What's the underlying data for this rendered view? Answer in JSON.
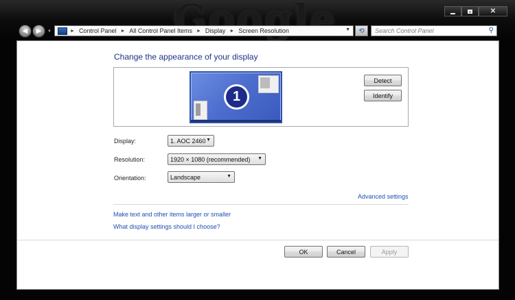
{
  "window": {
    "watermark": "Google",
    "caption": {
      "minimize": "",
      "maximize": "",
      "close": "✕"
    }
  },
  "nav": {
    "back_icon": "back-arrow-icon",
    "forward_icon": "forward-arrow-icon"
  },
  "breadcrumb": [
    "Control Panel",
    "All Control Panel Items",
    "Display",
    "Screen Resolution"
  ],
  "search": {
    "placeholder": "Search Control Panel"
  },
  "main": {
    "title": "Change the appearance of your display",
    "monitor_number": "1",
    "detect_label": "Detect",
    "identify_label": "Identify",
    "display_label": "Display:",
    "display_value": "1. AOC 2460",
    "resolution_label": "Resolution:",
    "resolution_value": "1920 × 1080 (recommended)",
    "orientation_label": "Orientation:",
    "orientation_value": "Landscape",
    "advanced_link": "Advanced settings",
    "link_text_size": "Make text and other items larger or smaller",
    "link_which": "What display settings should I choose?"
  },
  "footer": {
    "ok_label": "OK",
    "cancel_label": "Cancel",
    "apply_label": "Apply"
  },
  "colors": {
    "link": "#1c4fb3",
    "title": "#1e3287",
    "monitor": "#4e6fcf"
  }
}
